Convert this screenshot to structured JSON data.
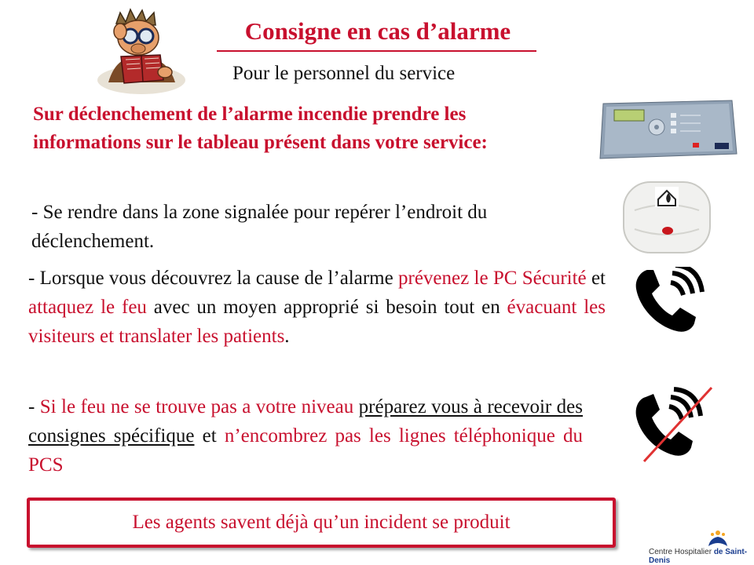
{
  "header": {
    "title": "Consigne en cas d’alarme",
    "subtitle": "Pour le personnel du service"
  },
  "lead": "Sur déclenchement de l’alarme incendie prendre les informations sur le tableau présent dans votre service:",
  "step1": "- Se rendre dans la zone signalée pour repérer l’endroit du déclenchement.",
  "step2": {
    "a": "- Lorsque vous découvrez la cause de l’alarme ",
    "b": "prévenez le PC Sécurité",
    "c": " et ",
    "d": "attaquez le feu",
    "e": " avec un moyen approprié si besoin tout en ",
    "f": "évacuant les visiteurs et translater les patients",
    "g": "."
  },
  "step3": {
    "a": "- ",
    "b": "Si le feu ne se trouve pas a votre niveau",
    "c": " ",
    "d": "préparez vous à recevoir des consignes spécifique",
    "e": " et ",
    "f": "n’encombrez pas les lignes téléphonique du PCS"
  },
  "banner": "Les agents savent déjà qu’un incident se produit",
  "logo": {
    "prefix": "Centre Hospitalier ",
    "name": "de Saint-Denis"
  },
  "colors": {
    "accent": "#c8102e",
    "logo_blue": "#1a3d8f",
    "logo_orange": "#f5a623"
  },
  "icons": [
    "reading-man-illustration",
    "alarm-panel-image",
    "smoke-detector-image",
    "phone-ringing-icon",
    "phone-crossed-icon",
    "hospital-logo-icon"
  ]
}
